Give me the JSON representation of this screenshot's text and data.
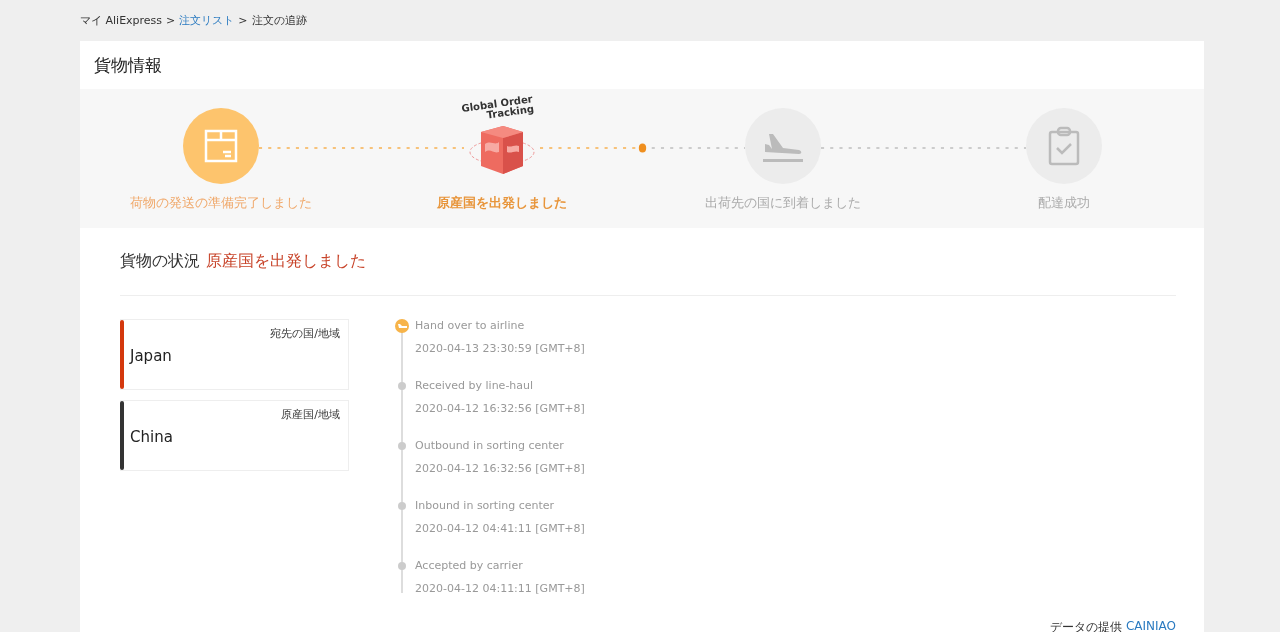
{
  "breadcrumb": [
    {
      "label": "マイ AliExpress",
      "link": false
    },
    {
      "label": "注文リスト",
      "link": true
    },
    {
      "label": "注文の追跡",
      "link": false
    }
  ],
  "breadcrumb_separator": ">",
  "panel_title": "貨物情報",
  "logo": {
    "line_1": "Global Order",
    "line_2": "Tracking"
  },
  "steps": [
    {
      "label": "荷物の発送の準備完了しました",
      "completed": true,
      "selected": false
    },
    {
      "label": "原産国を出発しました",
      "completed": true,
      "selected": true
    },
    {
      "label": "出荷先の国に到着しました",
      "completed": false,
      "selected": false
    },
    {
      "label": "配達成功",
      "completed": false,
      "selected": false
    }
  ],
  "status": {
    "label": "貨物の状況",
    "value": "原産国を出発しました"
  },
  "countries": [
    {
      "caption": "宛先の国/地域",
      "name": "Japan",
      "color": "#d4380d"
    },
    {
      "caption": "原産国/地域",
      "name": "China",
      "color": "#333333"
    }
  ],
  "events": [
    {
      "title": "Hand over to airline",
      "time": "2020-04-13 23:30:59 [GMT+8]",
      "current": true
    },
    {
      "title": "Received by line-haul",
      "time": "2020-04-12 16:32:56 [GMT+8]",
      "current": false
    },
    {
      "title": "Outbound in sorting center",
      "time": "2020-04-12 16:32:56 [GMT+8]",
      "current": false
    },
    {
      "title": "Inbound in sorting center",
      "time": "2020-04-12 04:41:11 [GMT+8]",
      "current": false
    },
    {
      "title": "Accepted by carrier",
      "time": "2020-04-12 04:11:11 [GMT+8]",
      "current": false
    }
  ],
  "footer": {
    "label": "データの提供",
    "provider": "CAINIAO"
  }
}
